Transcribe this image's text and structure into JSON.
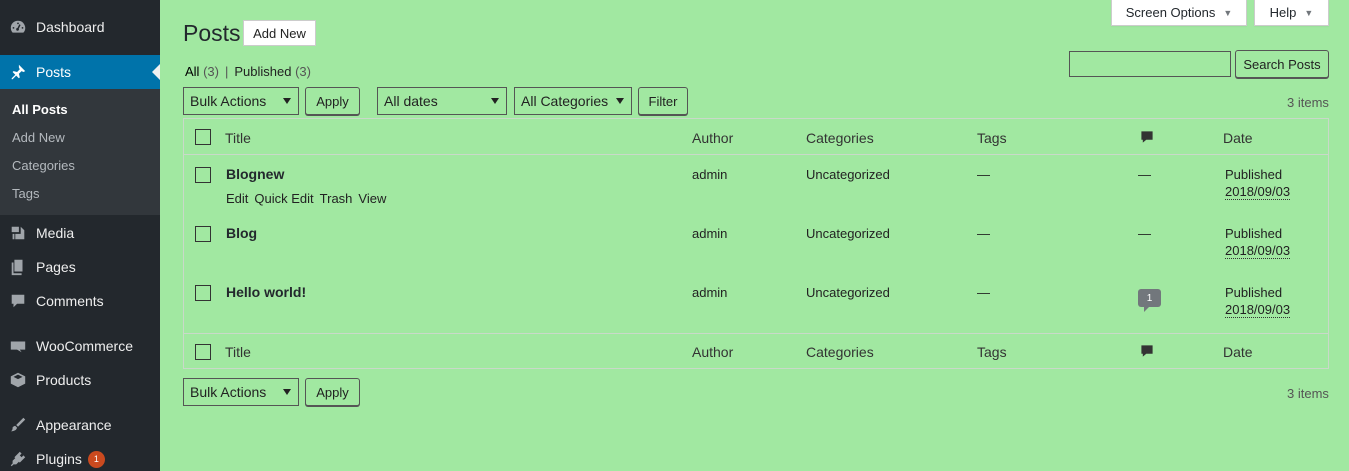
{
  "sidebar": {
    "items": [
      {
        "label": "Dashboard",
        "icon": "dashboard-icon"
      },
      {
        "label": "Posts",
        "icon": "pin-icon"
      },
      {
        "label": "Media",
        "icon": "media-icon"
      },
      {
        "label": "Pages",
        "icon": "pages-icon"
      },
      {
        "label": "Comments",
        "icon": "comment-icon"
      },
      {
        "label": "WooCommerce",
        "icon": "woo-icon"
      },
      {
        "label": "Products",
        "icon": "box-icon"
      },
      {
        "label": "Appearance",
        "icon": "brush-icon"
      },
      {
        "label": "Plugins",
        "icon": "plug-icon",
        "badge": "1"
      }
    ],
    "submenu": [
      "All Posts",
      "Add New",
      "Categories",
      "Tags"
    ]
  },
  "topbar": {
    "screen_options": "Screen Options",
    "help": "Help"
  },
  "page": {
    "title": "Posts",
    "add_new": "Add New"
  },
  "filters": {
    "all_label": "All",
    "all_count": "(3)",
    "published_label": "Published",
    "published_count": "(3)",
    "separator": "|",
    "search_button": "Search Posts",
    "bulk_actions": "Bulk Actions",
    "apply": "Apply",
    "dates": "All dates",
    "categories": "All Categories",
    "filter": "Filter",
    "items_count": "3 items"
  },
  "table": {
    "columns": {
      "title": "Title",
      "author": "Author",
      "categories": "Categories",
      "tags": "Tags",
      "date": "Date"
    },
    "rows": [
      {
        "title": "Blognew",
        "author": "admin",
        "categories": "Uncategorized",
        "tags": "—",
        "comments": "—",
        "status": "Published",
        "date": "2018/09/03"
      },
      {
        "title": "Blog",
        "author": "admin",
        "categories": "Uncategorized",
        "tags": "—",
        "comments": "—",
        "status": "Published",
        "date": "2018/09/03"
      },
      {
        "title": "Hello world!",
        "author": "admin",
        "categories": "Uncategorized",
        "tags": "—",
        "comments": "1",
        "status": "Published",
        "date": "2018/09/03"
      }
    ],
    "row_actions": [
      "Edit",
      "Quick Edit",
      "Trash",
      "View"
    ]
  }
}
